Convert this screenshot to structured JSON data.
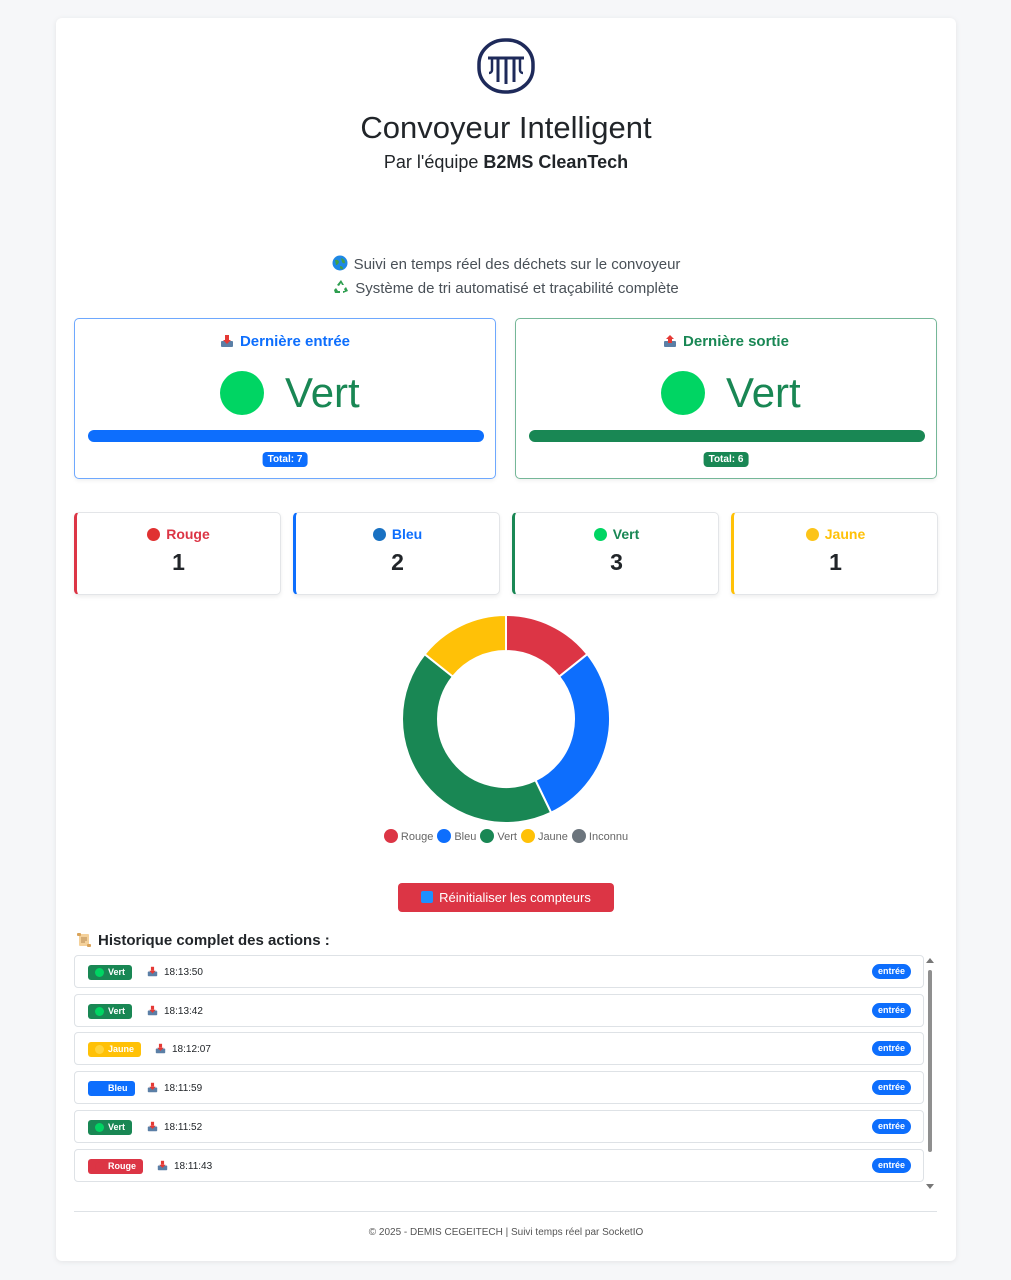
{
  "header": {
    "title": "Convoyeur Intelligent",
    "subtitle_prefix": "Par l'équipe ",
    "subtitle_team": "B2MS CleanTech"
  },
  "taglines": [
    {
      "icon": "globe-icon",
      "text": "Suivi en temps réel des déchets sur le convoyeur"
    },
    {
      "icon": "recycle-icon",
      "text": "Système de tri automatisé et traçabilité complète"
    }
  ],
  "last_entry": {
    "title": "Dernière entrée",
    "color_name": "Vert",
    "total_label": "Total: 7",
    "accent": "#0d6efd"
  },
  "last_exit": {
    "title": "Dernière sortie",
    "color_name": "Vert",
    "total_label": "Total: 6",
    "accent": "#198754"
  },
  "counters": [
    {
      "label": "Rouge",
      "count": "1",
      "color": "#dc3545",
      "border": "#dc3545"
    },
    {
      "label": "Bleu",
      "count": "2",
      "color": "#0d6efd",
      "border": "#0d6efd"
    },
    {
      "label": "Vert",
      "count": "3",
      "color": "#198754",
      "border": "#198754"
    },
    {
      "label": "Jaune",
      "count": "1",
      "color": "#ffc107",
      "border": "#ffc107"
    }
  ],
  "chart_data": {
    "type": "pie",
    "categories": [
      "Rouge",
      "Bleu",
      "Vert",
      "Jaune",
      "Inconnu"
    ],
    "values": [
      1,
      2,
      3,
      1,
      0
    ],
    "colors": [
      "#dc3545",
      "#0d6efd",
      "#198754",
      "#ffc107",
      "#6c757d"
    ],
    "legend_position": "bottom"
  },
  "reset_button": {
    "label": "Réinitialiser les compteurs"
  },
  "history": {
    "title": "Historique complet des actions :",
    "rows": [
      {
        "color": "Vert",
        "badge_bg": "#198754",
        "dot": "#00d563",
        "time": "18:13:50",
        "direction": "entrée"
      },
      {
        "color": "Vert",
        "badge_bg": "#198754",
        "dot": "#00d563",
        "time": "18:13:42",
        "direction": "entrée"
      },
      {
        "color": "Jaune",
        "badge_bg": "#ffc107",
        "dot": "#ffd43b",
        "time": "18:12:07",
        "direction": "entrée"
      },
      {
        "color": "Bleu",
        "badge_bg": "#0d6efd",
        "dot": "#0d6efd",
        "time": "18:11:59",
        "direction": "entrée"
      },
      {
        "color": "Vert",
        "badge_bg": "#198754",
        "dot": "#00d563",
        "time": "18:11:52",
        "direction": "entrée"
      },
      {
        "color": "Rouge",
        "badge_bg": "#dc3545",
        "dot": "#dc3545",
        "time": "18:11:43",
        "direction": "entrée"
      }
    ]
  },
  "footer": {
    "text": "© 2025 - DEMIS CEGEITECH | Suivi temps réel par SocketIO"
  }
}
